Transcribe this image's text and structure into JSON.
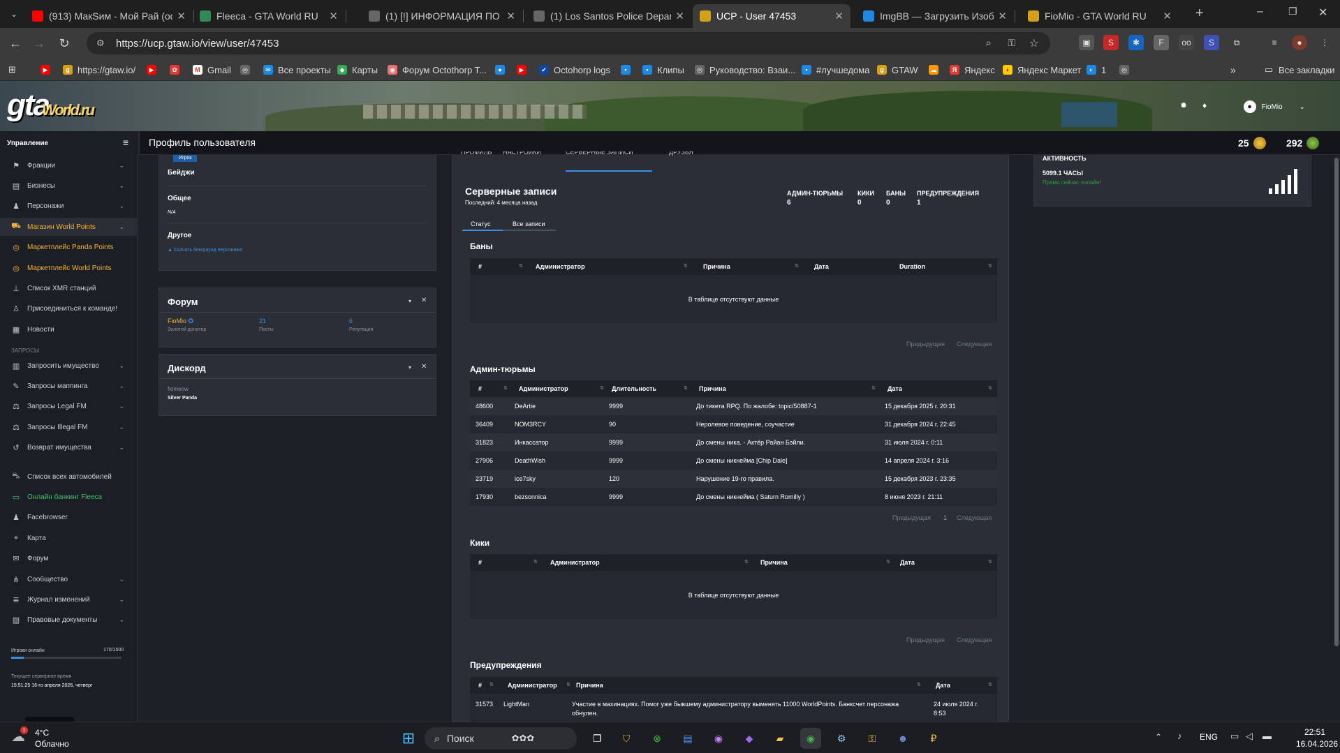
{
  "browser": {
    "tabs": [
      {
        "title": "(913) МакSим - Мой Рай (офи",
        "icon": "youtube-icon",
        "color": "#ff0000"
      },
      {
        "title": "Fleeca - GTA World RU",
        "icon": "fleeca-icon",
        "color": "#2e8b57"
      },
      {
        "title": "(1) [!] ИНФОРМАЦИЯ ПО ПРО",
        "icon": "globe-icon",
        "color": "#666666"
      },
      {
        "title": "(1) Los Santos Police Departme",
        "icon": "globe-icon",
        "color": "#666666"
      },
      {
        "title": "UCP - User 47453",
        "icon": "gtaw-icon",
        "color": "#d4a017"
      },
      {
        "title": "ImgBB — Загрузить Изображ",
        "icon": "imgbb-icon",
        "color": "#1e88e5"
      },
      {
        "title": "FioMio - GTA World RU",
        "icon": "gtaw-icon",
        "color": "#d4a017"
      }
    ],
    "url": "https://ucp.gtaw.io/view/user/47453",
    "bookmarks": [
      "https://gtaw.io/",
      "Gmail",
      "Все проекты",
      "Карты",
      "Форум Octothorp T...",
      "Octohorp logs",
      "Клипы",
      "Руководство: Взаи...",
      "#лучшедома",
      "GTAW",
      "Яндекс",
      "Яндекс Маркет",
      "1"
    ],
    "all_bookmarks": "Все закладки"
  },
  "header": {
    "logo": "gta",
    "logo_sub": "World.ru",
    "username": "FioMio",
    "sidebar_title": "Управление",
    "page_title": "Профиль пользователя",
    "stat_points": "25",
    "stat_panda": "292"
  },
  "sidebar": {
    "items": [
      {
        "label": "Фракции",
        "icon": "flag-icon",
        "chev": true
      },
      {
        "label": "Бизнесы",
        "icon": "briefcase-icon",
        "chev": true
      },
      {
        "label": "Персонажи",
        "icon": "user-icon",
        "chev": true
      },
      {
        "label": "Магазин World Points",
        "icon": "cart-icon",
        "chev": true
      },
      {
        "label": "Маркетплейс Panda Points",
        "icon": "coins-icon",
        "chev": false
      },
      {
        "label": "Маркетплейс World Points",
        "icon": "coins-icon",
        "chev": false
      },
      {
        "label": "Список XMR станций",
        "icon": "antenna-icon",
        "chev": false
      },
      {
        "label": "Присоединиться к команде!",
        "icon": "user-plus-icon",
        "chev": false
      },
      {
        "label": "Новости",
        "icon": "news-icon",
        "chev": false
      }
    ],
    "section_requests": "ЗАПРОСЫ",
    "requests": [
      {
        "label": "Запросить имущество",
        "icon": "building-icon",
        "chev": true
      },
      {
        "label": "Запросы маппинга",
        "icon": "brush-icon",
        "chev": true
      },
      {
        "label": "Запросы Legal FM",
        "icon": "scale-icon",
        "chev": true
      },
      {
        "label": "Запросы Illegal FM",
        "icon": "scale-icon",
        "chev": true
      },
      {
        "label": "Возврат имущества",
        "icon": "undo-icon",
        "chev": true
      }
    ],
    "other": [
      {
        "label": "Список всех автомобилей",
        "icon": "car-icon",
        "chev": false
      },
      {
        "label": "Онлайн банкинг Fleeca",
        "icon": "bank-icon",
        "chev": false
      },
      {
        "label": "Facebrowser",
        "icon": "users-icon",
        "chev": false
      },
      {
        "label": "Карта",
        "icon": "map-icon",
        "chev": false
      },
      {
        "label": "Форум",
        "icon": "comments-icon",
        "chev": false
      },
      {
        "label": "Сообщество",
        "icon": "share-icon",
        "chev": true
      },
      {
        "label": "Журнал изменений",
        "icon": "list-icon",
        "chev": true
      },
      {
        "label": "Правовые документы",
        "icon": "document-icon",
        "chev": true
      }
    ],
    "players_label": "Игроки онлайн",
    "players_count": "170/1500",
    "players_fraction": 0.113,
    "server_time_label": "Текущее серверное время",
    "server_time": "15:51:25 16-го апреля 2026, четверг"
  },
  "profile": {
    "role_badge": "Игрок",
    "badges_label": "Бейджи",
    "general_label": "Общее",
    "general_value": "N/A",
    "other_label": "Другое",
    "download_link": "Скачать бекграунд персонажа"
  },
  "forum": {
    "title": "Форум",
    "name": "FioMio",
    "name_sub": "Золотой донатер",
    "posts": "21",
    "posts_label": "Посты",
    "rep": "6",
    "rep_label": "Репутация"
  },
  "discord": {
    "title": "Дискорд",
    "name": "fiomeow",
    "role": "Silver Panda"
  },
  "main": {
    "top_tabs": [
      "ПРОФИЛЬ",
      "НАСТРОЙКИ",
      "СЕРВЕРНЫЕ ЗАПИСИ",
      "ДРУЗЬЯ"
    ],
    "title": "Серверные записи",
    "subtitle": "Последний: 4 месяца назад",
    "counters": [
      {
        "label": "АДМИН-ТЮРЬМЫ",
        "value": "6"
      },
      {
        "label": "КИКИ",
        "value": "0"
      },
      {
        "label": "БАНЫ",
        "value": "0"
      },
      {
        "label": "ПРЕДУПРЕЖДЕНИЯ",
        "value": "1"
      }
    ],
    "subtabs": [
      "Статус",
      "Все записи"
    ],
    "empty_text": "В таблице отсутствуют данные",
    "prev": "Предыдущая",
    "next": "Следующая",
    "page": "1",
    "bans": {
      "title": "Баны",
      "headers": [
        "#",
        "Администратор",
        "Причина",
        "Дата",
        "Duration"
      ]
    },
    "jails": {
      "title": "Админ-тюрьмы",
      "headers": [
        "#",
        "Администратор",
        "Длительность",
        "Причина",
        "Дата"
      ],
      "rows": [
        [
          "48600",
          "DeArtie",
          "9999",
          "До тикета RPQ. По жалобе: topic/50887-1",
          "15 декабря 2025 г. 20:31"
        ],
        [
          "36409",
          "NOM3RCY",
          "90",
          "Неролевое поведение, соучастие",
          "31 декабря 2024 г. 22:45"
        ],
        [
          "31823",
          "Инкассатор",
          "9999",
          "До смены ника. - Актёр Райан Бэйли.",
          "31 июля 2024 г. 0:11"
        ],
        [
          "27906",
          "DeathWish",
          "9999",
          "До смены никнейма [Chip Dale]",
          "14 апреля 2024 г. 3:16"
        ],
        [
          "23719",
          "ice7sky",
          "120",
          "Нарушение 19-го правила.",
          "15 декабря 2023 г. 23:35"
        ],
        [
          "17930",
          "bezsonnica",
          "9999",
          "До смены никнейма ( Saturn Romilly )",
          "8 июня 2023 г. 21:11"
        ]
      ]
    },
    "kicks": {
      "title": "Кики",
      "headers": [
        "#",
        "Администратор",
        "Причина",
        "Дата"
      ]
    },
    "warnings": {
      "title": "Предупреждения",
      "headers": [
        "#",
        "Администратор",
        "Причина",
        "Дата"
      ],
      "rows": [
        [
          "31573",
          "LightMan",
          "Участие в махинациях. Помог уже бывшему администратору выменять 11000 WorldPoints. Банксчет персонажа",
          "обнулен.",
          "24 июля 2024 г.",
          "8:53"
        ]
      ]
    }
  },
  "activity": {
    "title": "АКТИВНОСТЬ",
    "hours": "5099.1 ЧАСЫ",
    "status": "Прямо сейчас онлайн!"
  },
  "taskbar": {
    "weather_temp": "4°C",
    "weather_desc": "Облачно",
    "search": "Поиск",
    "lang": "ENG",
    "time": "22:51",
    "date": "16.04.2026"
  }
}
